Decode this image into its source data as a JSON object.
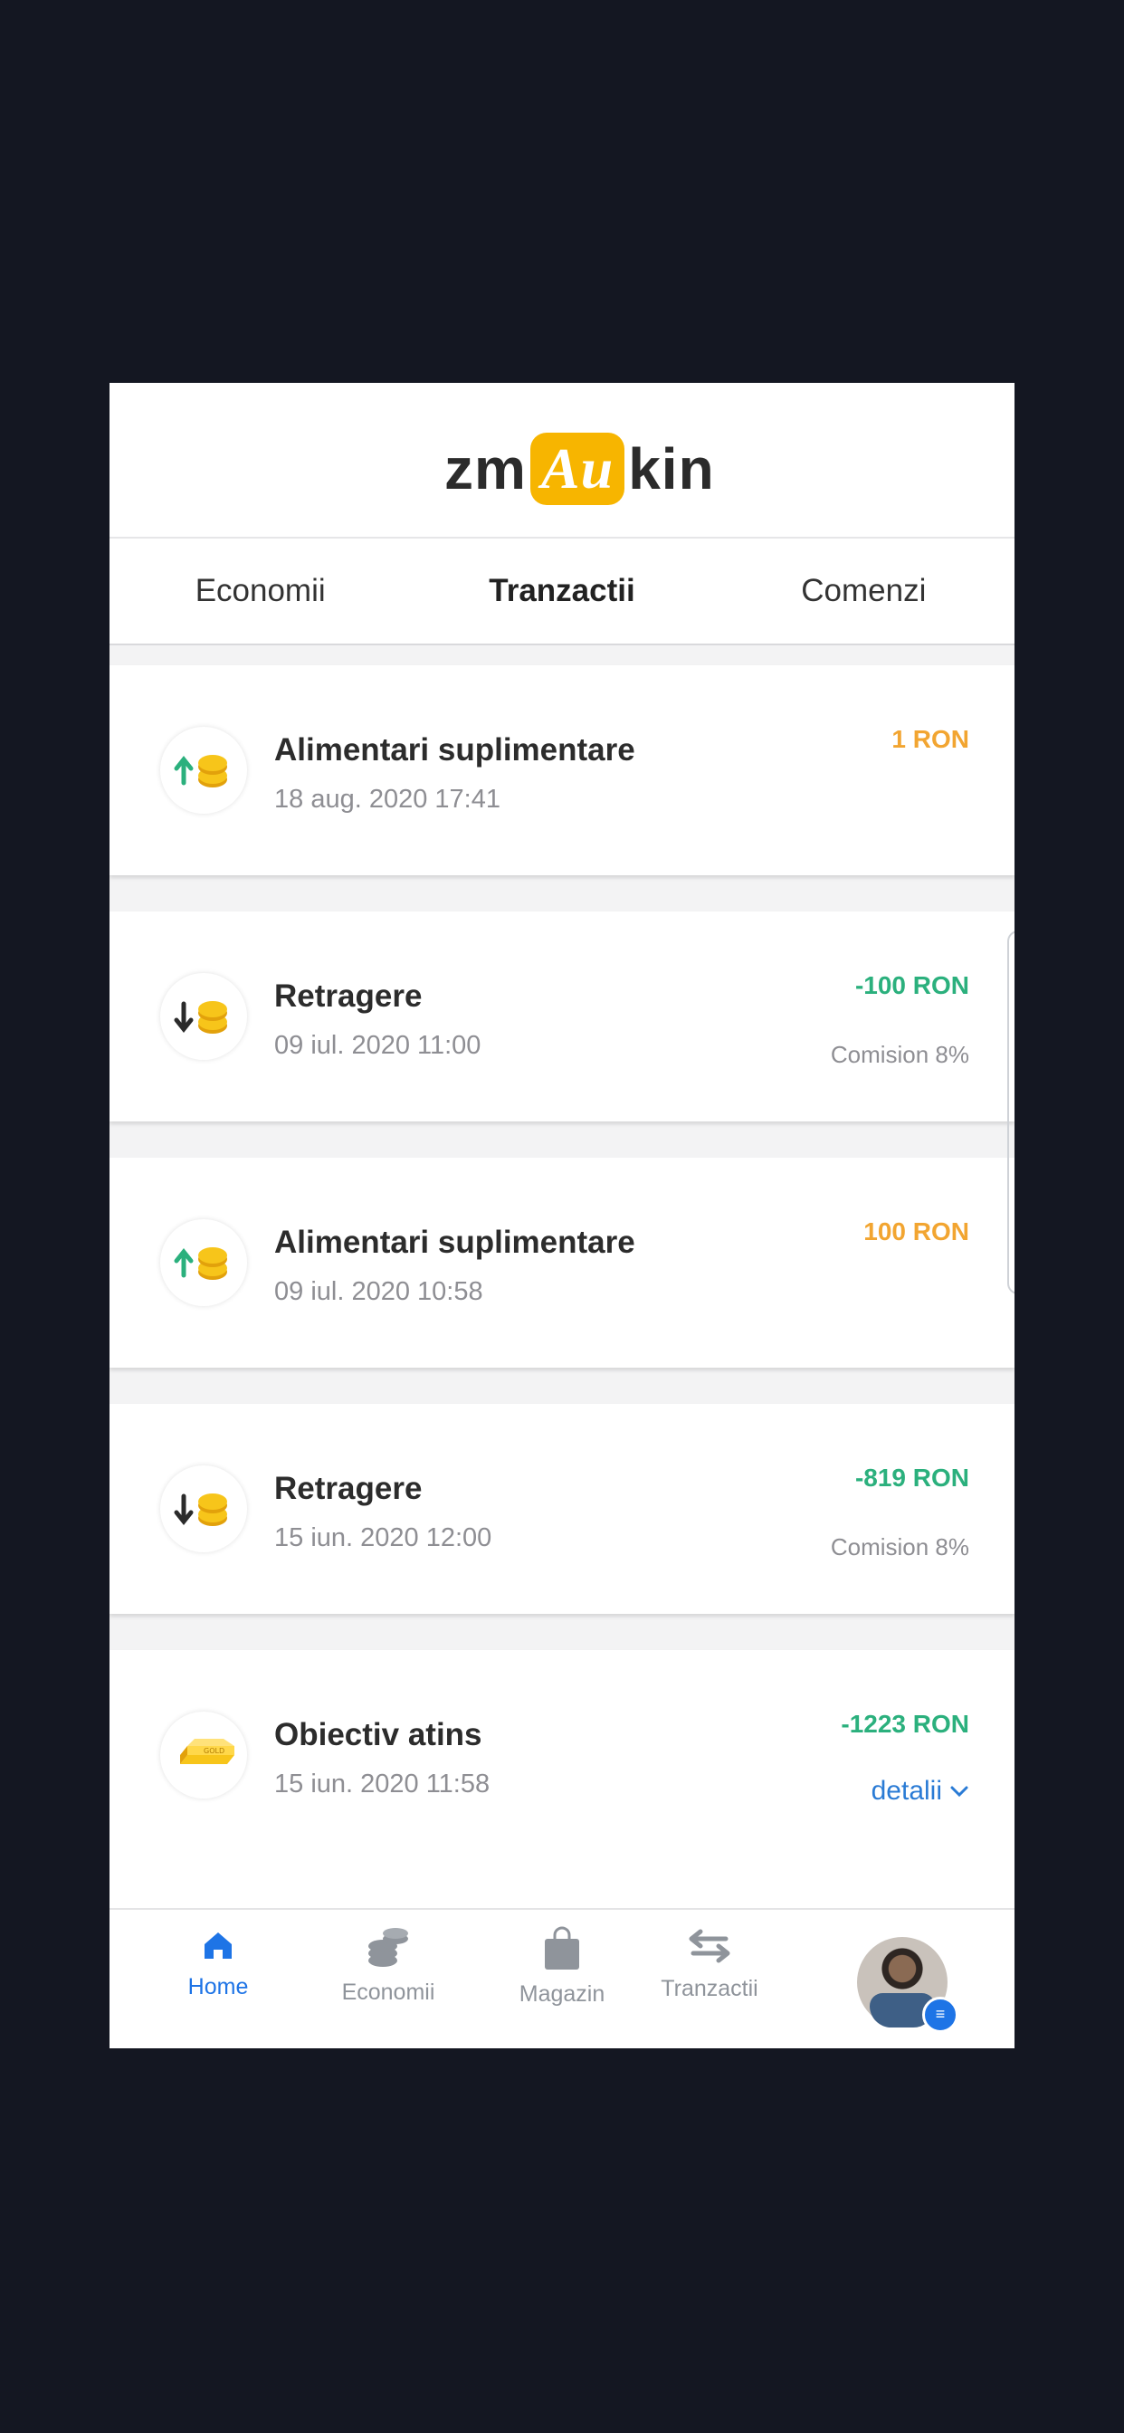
{
  "app": {
    "logo_pre": "zm",
    "logo_mid": "Au",
    "logo_post": "kin"
  },
  "tabs": [
    {
      "label": "Economii",
      "active": false
    },
    {
      "label": "Tranzactii",
      "active": true
    },
    {
      "label": "Comenzi",
      "active": false
    }
  ],
  "transactions": [
    {
      "icon": "deposit-coins-icon",
      "title": "Alimentari suplimentare",
      "date": "18 aug. 2020 17:41",
      "amount": "1 RON",
      "kind": "plus"
    },
    {
      "icon": "withdraw-coins-icon",
      "title": "Retragere",
      "date": "09 iul. 2020 11:00",
      "amount": "-100 RON",
      "kind": "minus",
      "note": "Comision 8%"
    },
    {
      "icon": "deposit-coins-icon",
      "title": "Alimentari suplimentare",
      "date": "09 iul. 2020 10:58",
      "amount": "100 RON",
      "kind": "plus"
    },
    {
      "icon": "withdraw-coins-icon",
      "title": "Retragere",
      "date": "15 iun. 2020 12:00",
      "amount": "-819 RON",
      "kind": "minus",
      "note": "Comision 8%"
    },
    {
      "icon": "gold-bar-icon",
      "title": "Obiectiv atins",
      "date": "15 iun. 2020 11:58",
      "amount": "-1223 RON",
      "kind": "minus",
      "details_label": "detalii"
    }
  ],
  "bottom_nav": [
    {
      "label": "Home",
      "icon": "home-icon",
      "active": true
    },
    {
      "label": "Economii",
      "icon": "coins-stack-icon",
      "active": false
    },
    {
      "label": "Magazin",
      "icon": "shopping-bag-icon",
      "active": false
    },
    {
      "label": "Tranzactii",
      "icon": "transfer-arrows-icon",
      "active": false
    }
  ],
  "colors": {
    "accent_blue": "#1e74e6",
    "positive_orange": "#f2a531",
    "negative_green": "#2bb07d",
    "gold": "#f7b500"
  }
}
